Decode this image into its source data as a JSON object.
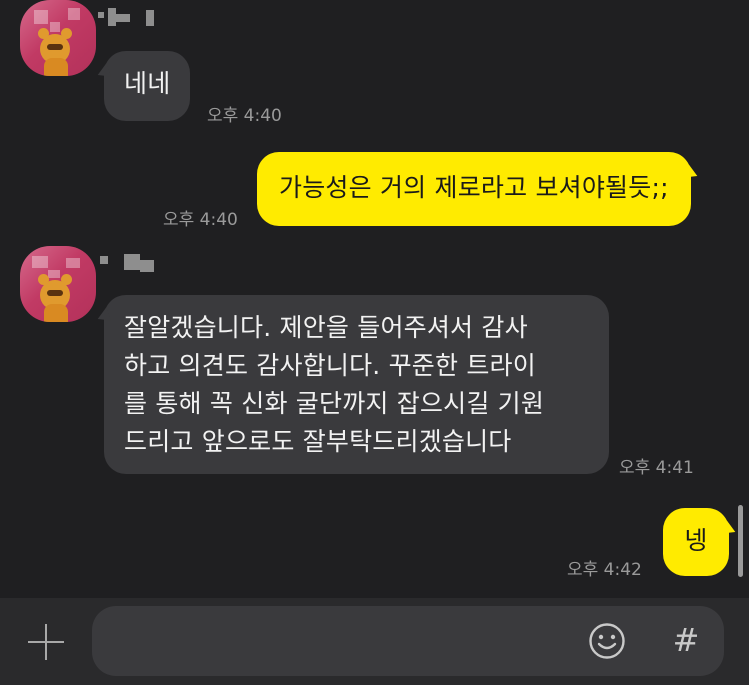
{
  "chat": {
    "messages": [
      {
        "sender": "other",
        "text": "네네",
        "time": "오후 4:40"
      },
      {
        "sender": "me",
        "text": "가능성은 거의 제로라고 보셔야될듯;;",
        "time": "오후 4:40"
      },
      {
        "sender": "other",
        "lines": [
          "잘알겠습니다. 제안을 들어주셔서 감사",
          "하고 의견도 감사합니다. 꾸준한 트라이",
          "를 통해 꼭 신화 굴단까지 잡으시길 기원",
          "드리고 앞으로도 잘부탁드리겠습니다"
        ],
        "time": "오후 4:41"
      },
      {
        "sender": "me",
        "text": "넹",
        "time": "오후 4:42"
      }
    ]
  },
  "input_bar": {
    "plus_icon": "plus-icon",
    "emoji_icon": "smiley-icon",
    "hash_label": "#",
    "message_value": ""
  },
  "colors": {
    "background": "#1f1f21",
    "incoming_bubble": "#3a3a3d",
    "outgoing_bubble": "#ffeb00",
    "timestamp": "#9a9a9a"
  }
}
